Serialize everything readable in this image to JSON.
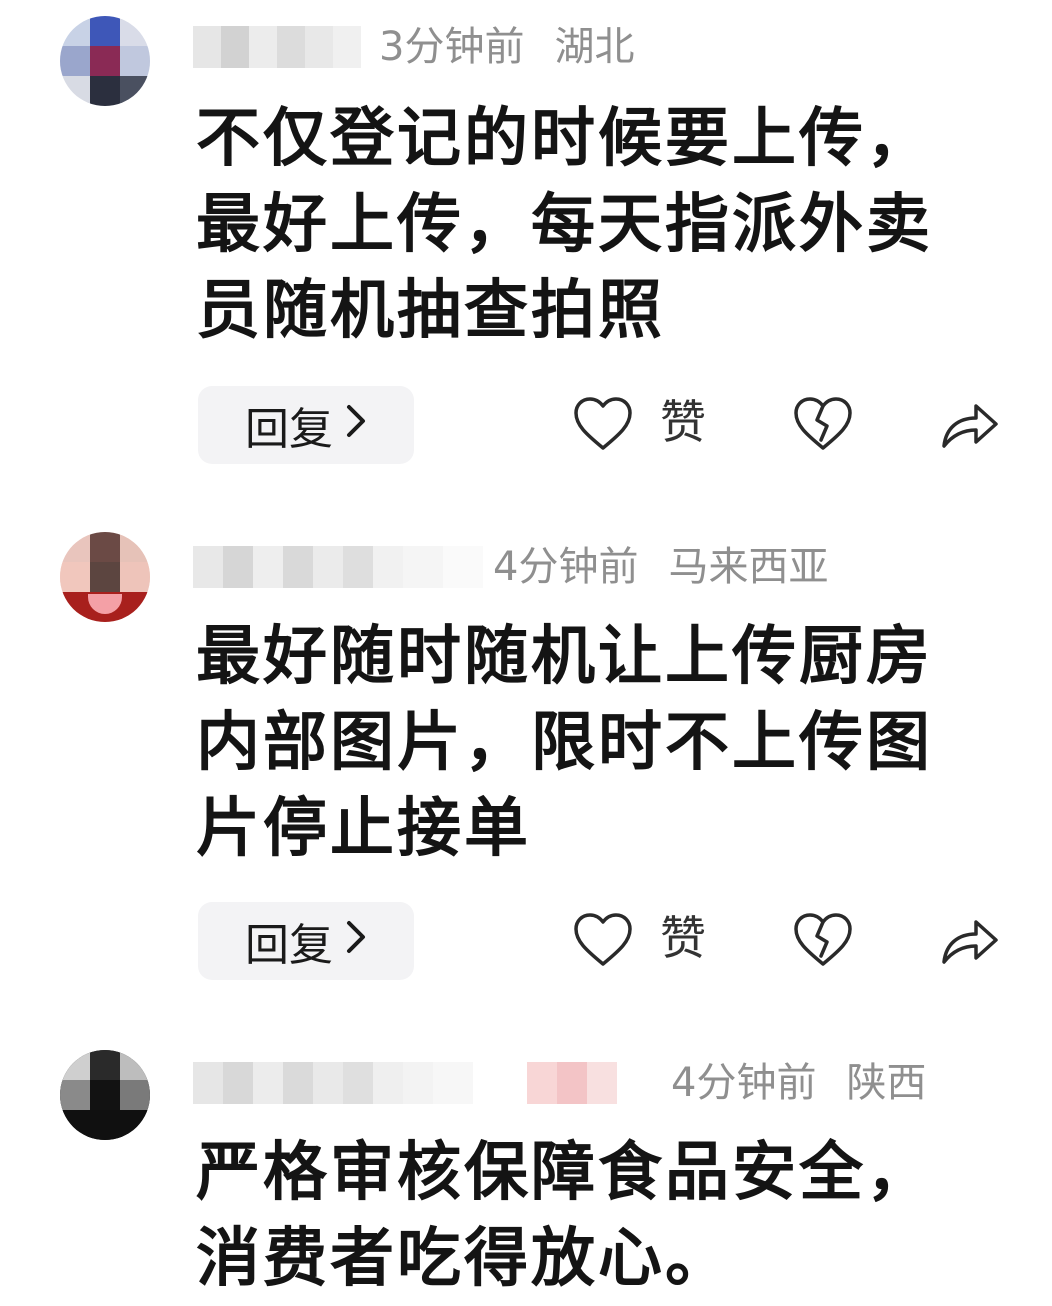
{
  "comments": [
    {
      "time": "3分钟前",
      "region": "湖北",
      "text": "不仅登记的时候要上传，最好上传，每天指派外卖员随机抽查拍照",
      "reply_label": "回复",
      "like_label": "赞"
    },
    {
      "time": "4分钟前",
      "region": "马来西亚",
      "text": "最好随时随机让上传厨房内部图片，限时不上传图片停止接单",
      "reply_label": "回复",
      "like_label": "赞"
    },
    {
      "time": "4分钟前",
      "region": "陕西",
      "text": "严格审核保障食品安全，消费者吃得放心。"
    }
  ],
  "icons": {
    "like": "heart-outline-icon",
    "dislike": "broken-heart-icon",
    "share": "share-arrow-icon",
    "reply_chevron": "chevron-right-icon"
  },
  "colors": {
    "meta_gray": "#8f8f8f",
    "reply_bg": "#f3f3f5",
    "text": "#141414"
  }
}
